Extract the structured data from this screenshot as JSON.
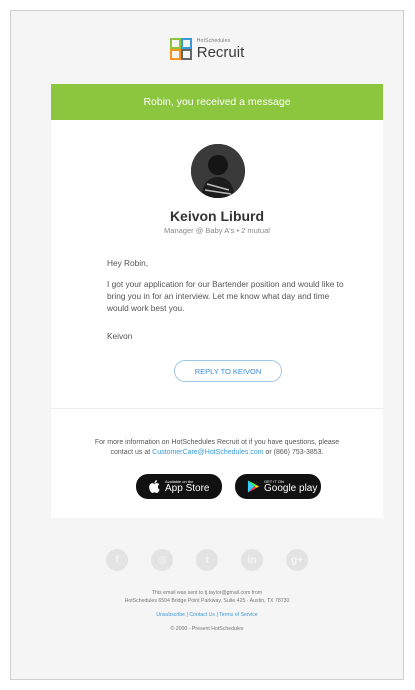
{
  "logo": {
    "small_text": "HotSchedules",
    "big_text": "Recruit"
  },
  "banner": {
    "text": "Robin, you received a message"
  },
  "sender": {
    "name": "Keivon Liburd",
    "role": "Manager @ Baby A's • 2 mutual"
  },
  "message": {
    "greeting": "Hey Robin,",
    "body": "I got your application for our Bartender position and would like to bring you in for an interview. Let me know what day and time would work best you.",
    "signature": "Keivon"
  },
  "reply_button": {
    "label": "REPLY TO KEIVON"
  },
  "info": {
    "line1": "For more information on HotSchedules Recruit ot if you have questions, please",
    "line2_prefix": "contact us at",
    "email": "CustomerCare@HotSchedules.com",
    "line2_suffix": "or (866) 753-3853."
  },
  "app_store": {
    "small": "Available on the",
    "big": "App Store"
  },
  "google_play": {
    "small": "GET IT ON",
    "big": "Google play"
  },
  "social": [
    {
      "name": "facebook-icon",
      "glyph": "f"
    },
    {
      "name": "instagram-icon",
      "glyph": "◎"
    },
    {
      "name": "twitter-icon",
      "glyph": "t"
    },
    {
      "name": "linkedin-icon",
      "glyph": "in"
    },
    {
      "name": "google-plus-icon",
      "glyph": "g+"
    }
  ],
  "footer": {
    "line1": "This email was sent to tj.taylor@gmail.com from",
    "line2": "HotSchedules 6504 Bridge Point Parkway, Suite 425 · Austin, TX 78730",
    "unsubscribe": "Unsubscribe",
    "contact": "Contact Us",
    "terms": "Terms of Service",
    "copyright": "© 2000 - Present HotSchedules"
  },
  "colors": {
    "banner": "#8cc63f",
    "link": "#3a9ad9",
    "button_border": "#9cc7e8"
  }
}
